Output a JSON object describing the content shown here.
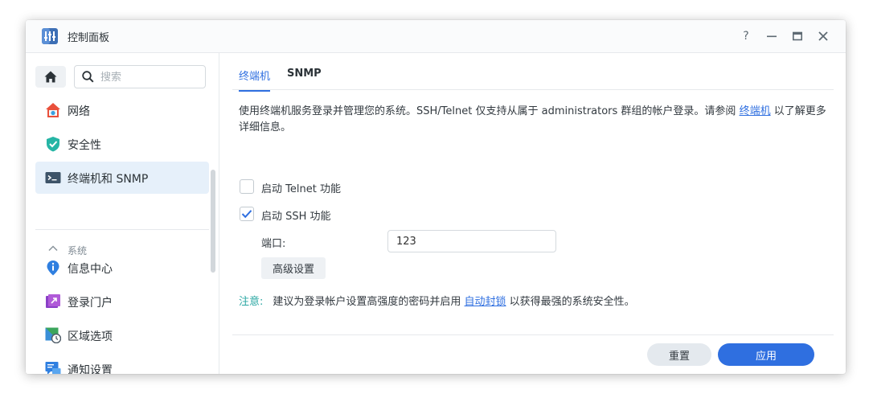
{
  "window": {
    "title": "控制面板",
    "controls": {
      "help": "?",
      "minimize": "—",
      "maximize": "☐",
      "close": "✕"
    }
  },
  "sidebar": {
    "search_placeholder": "搜索",
    "items": [
      {
        "label": "网络",
        "icon": "house-network-icon"
      },
      {
        "label": "安全性",
        "icon": "shield-check-icon"
      },
      {
        "label": "终端机和 SNMP",
        "icon": "terminal-icon",
        "active": true
      }
    ],
    "group": {
      "label": "系统",
      "icon": "chevron-up-icon"
    },
    "group_items": [
      {
        "label": "信息中心",
        "icon": "info-icon"
      },
      {
        "label": "登录门户",
        "icon": "login-portal-icon"
      },
      {
        "label": "区域选项",
        "icon": "region-clock-icon"
      },
      {
        "label": "通知设置",
        "icon": "notification-icon"
      }
    ]
  },
  "tabs": [
    {
      "label": "终端机",
      "active": true
    },
    {
      "label": "SNMP",
      "active": false
    }
  ],
  "content": {
    "description_before": "使用终端机服务登录并管理您的系统。SSH/Telnet 仅支持从属于 administrators 群组的帐户登录。请参阅 ",
    "description_link": "终端机",
    "description_after": " 以了解更多详细信息。",
    "telnet_label": "启动 Telnet 功能",
    "telnet_checked": false,
    "ssh_label": "启动 SSH 功能",
    "ssh_checked": true,
    "port_label": "端口:",
    "port_value": "123",
    "advanced_button": "高级设置",
    "note_label": "注意:",
    "note_before": "建议为登录帐户设置高强度的密码并启用 ",
    "note_link": "自动封锁",
    "note_after": " 以获得最强的系统安全性。"
  },
  "footer": {
    "reset_label": "重置",
    "apply_label": "应用"
  },
  "colors": {
    "accent": "#2f6fe0",
    "note": "#2aa7a3",
    "active_nav_bg": "#e6f0fa"
  }
}
